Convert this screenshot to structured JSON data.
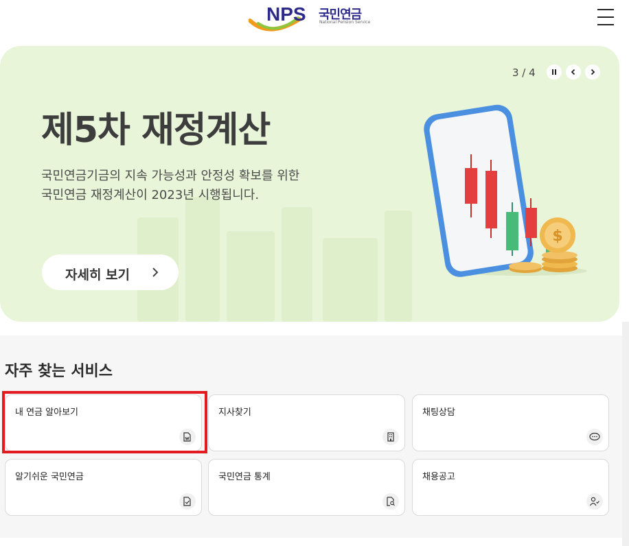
{
  "header": {
    "logo_text": "NPS",
    "logo_ko": "국민연금",
    "logo_en": "National Pension Service"
  },
  "banner": {
    "pager": "3 / 4",
    "headline": "제5차 재정계산",
    "desc_line1": "국민연금기금의 지속 가능성과 안정성 확보를 위한",
    "desc_line2": "국민연금 재정계산이 2023년 시행됩니다.",
    "more_label": "자세히 보기"
  },
  "services": {
    "title": "자주 찾는 서비스",
    "items": [
      {
        "label": "내 연금 알아보기",
        "icon": "document-won-icon"
      },
      {
        "label": "지사찾기",
        "icon": "building-icon"
      },
      {
        "label": "채팅상담",
        "icon": "chat-bubble-icon"
      },
      {
        "label": "알기쉬운 국민연금",
        "icon": "document-check-icon"
      },
      {
        "label": "국민연금 통계",
        "icon": "document-search-icon"
      },
      {
        "label": "채용공고",
        "icon": "person-check-icon"
      }
    ]
  },
  "colors": {
    "banner_bg": "#e9f5d8",
    "logo_blue": "#2d2a8c",
    "highlight": "#e21b23"
  }
}
